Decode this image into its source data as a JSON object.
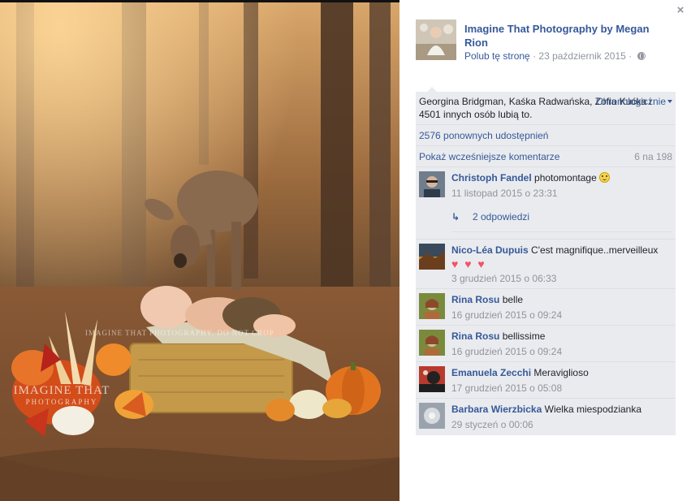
{
  "close_label": "×",
  "page": {
    "name": "Imagine That Photography by Megan Rion",
    "like_link": "Polub tę stronę",
    "separator": "·",
    "date": "23 październik 2015",
    "date_separator": "·"
  },
  "photo": {
    "watermark_center": "IMAGINE THAT PHOTOGRAPHY. DO NOT CROP",
    "logo_line1": "IMAGINE THAT",
    "logo_line2": "PHOTOGRAPHY"
  },
  "feedback": {
    "likes": "Georgina Bridgman, Kaśka Radwańska, Zofia Kućka i 4501 innych osób lubią to.",
    "order": "Chronologicznie",
    "shares": "2576 ponownych udostępnień",
    "previous_comments": "Pokaż wcześniejsze komentarze",
    "count": "6 na 198"
  },
  "comments": [
    {
      "author": "Christoph Fandel",
      "text": "photomontage",
      "time": "11 listopad 2015 o 23:31",
      "replies": "2 odpowiedzi",
      "avatar_color": "#6f7d8c"
    },
    {
      "author": "Nico-Léa Dupuis",
      "text": "C'est magnifique..merveilleux",
      "hearts": "♥ ♥ ♥",
      "time": "3 grudzień 2015 o 06:33",
      "avatar_color": "#c98a2c"
    },
    {
      "author": "Rina Rosu",
      "text": "belle",
      "time": "16 grudzień 2015 o 09:24",
      "avatar_color": "#7a8a3c"
    },
    {
      "author": "Rina Rosu",
      "text": "bellissime",
      "time": "16 grudzień 2015 o 09:24",
      "avatar_color": "#7a8a3c"
    },
    {
      "author": "Emanuela Zecchi",
      "text": "Meraviglioso",
      "time": "17 grudzień 2015 o 05:08",
      "avatar_color": "#b83a2e"
    },
    {
      "author": "Barbara Wierzbicka",
      "text": "Wielka miespodzianka",
      "time": "29 styczeń o 00:06",
      "avatar_color": "#9aa3ad"
    }
  ],
  "colors": {
    "link": "#365899",
    "meta": "#90949c",
    "panel": "#e9ebee",
    "heart": "#f25268"
  }
}
